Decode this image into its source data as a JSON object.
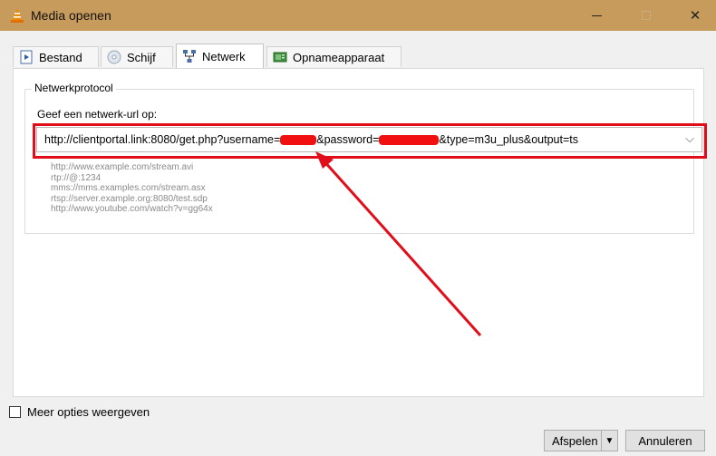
{
  "window": {
    "title": "Media openen",
    "close_glyph": "✕",
    "titlebar_color": "#c79b5c"
  },
  "tabs": [
    {
      "label": "Bestand",
      "icon": "file-play-icon"
    },
    {
      "label": "Schijf",
      "icon": "disc-icon"
    },
    {
      "label": "Netwerk",
      "icon": "network-icon",
      "active": true
    },
    {
      "label": "Opnameapparaat",
      "icon": "capture-device-icon"
    }
  ],
  "network": {
    "group_title": "Netwerkprotocol",
    "url_label": "Geef een netwerk-url op:",
    "url_part1": "http://clientportal.link:8080/get.php?username=",
    "url_part2": "&password=",
    "url_part3": "&type=m3u_plus&output=ts",
    "dropdown_glyph": "⌵",
    "examples": [
      "http://www.example.com/stream.avi",
      "rtp://@:1234",
      "mms://mms.examples.com/stream.asx",
      "rtsp://server.example.org:8080/test.sdp",
      "http://www.youtube.com/watch?v=gg64x"
    ],
    "annotation_color": "#e10d1a"
  },
  "footer": {
    "more_options_label": "Meer opties weergeven",
    "play_label": "Afspelen",
    "play_dropdown_glyph": "▼",
    "cancel_label": "Annuleren"
  }
}
